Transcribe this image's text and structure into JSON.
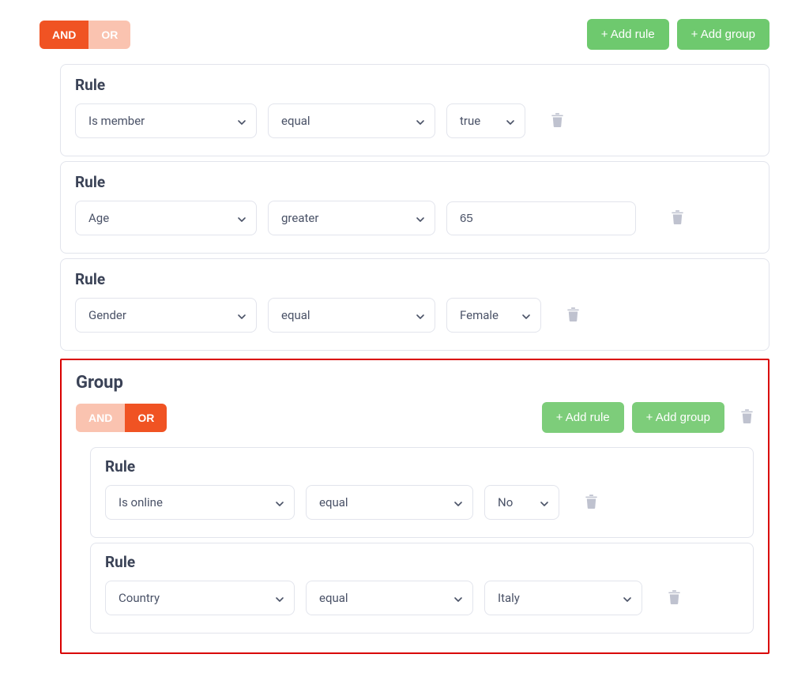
{
  "logic": {
    "and": "AND",
    "or": "OR"
  },
  "buttons": {
    "add_rule": "+ Add rule",
    "add_group": "+ Add group"
  },
  "labels": {
    "rule": "Rule",
    "group": "Group"
  },
  "rules": [
    {
      "field": "Is member",
      "op": "equal",
      "value": "true"
    },
    {
      "field": "Age",
      "op": "greater",
      "value": "65"
    },
    {
      "field": "Gender",
      "op": "equal",
      "value": "Female"
    }
  ],
  "group": {
    "rules": [
      {
        "field": "Is online",
        "op": "equal",
        "value": "No"
      },
      {
        "field": "Country",
        "op": "equal",
        "value": "Italy"
      }
    ]
  }
}
